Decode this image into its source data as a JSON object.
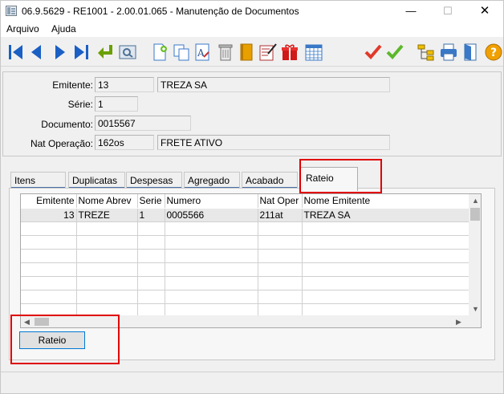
{
  "window": {
    "title": "06.9.5629 - RE1001 - 2.00.01.065 - Manutenção de Documentos",
    "min_glyph": "—",
    "max_glyph": "☐",
    "close_glyph": "✕"
  },
  "menu": {
    "items": [
      "Arquivo",
      "Ajuda"
    ]
  },
  "toolbar": {
    "icons": [
      "first-record-icon",
      "previous-record-icon",
      "next-record-icon",
      "last-record-icon",
      "go-to-icon",
      "search-icon",
      "new-document-icon",
      "copy-icon",
      "edit-text-icon",
      "delete-icon",
      "book-icon",
      "notes-icon",
      "gift-icon",
      "calendar-icon",
      "confirm-icon",
      "ok-icon",
      "tree-icon",
      "print-icon",
      "exit-icon",
      "help-icon"
    ]
  },
  "header": {
    "emitente_label": "Emitente:",
    "emitente_code": "13",
    "emitente_name": "TREZA SA",
    "serie_label": "Série:",
    "serie_value": "1",
    "documento_label": "Documento:",
    "documento_value": "0015567",
    "natop_label": "Nat Operação:",
    "natop_code": "162os",
    "natop_desc": "FRETE ATIVO"
  },
  "tabs": [
    "Itens",
    "Duplicatas",
    "Despesas",
    "Agregado",
    "Acabado",
    "Rateio"
  ],
  "active_tab": "Rateio",
  "grid": {
    "columns": [
      "Emitente",
      "Nome Abrev",
      "Serie",
      "Numero",
      "Nat Oper",
      "Nome Emitente"
    ],
    "rows": [
      [
        "13",
        "TREZE",
        "1",
        "0005566",
        "211at",
        "TREZA SA"
      ]
    ]
  },
  "rateio_button": "Rateio",
  "colors": {
    "highlight": "#e00000",
    "tab_bar": "#4a6fa5",
    "focus_border": "#0078d7"
  }
}
